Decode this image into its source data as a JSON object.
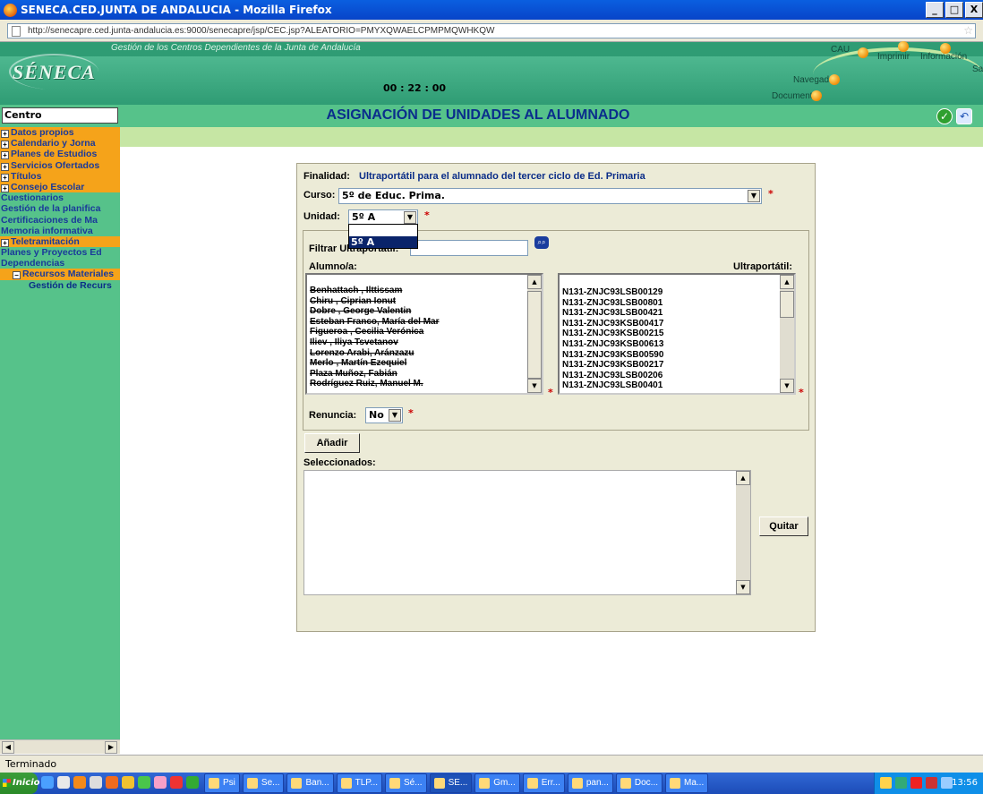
{
  "window": {
    "title": "SENECA.CED.JUNTA DE ANDALUCIA - Mozilla Firefox",
    "buttons": [
      "_",
      "□",
      "X"
    ]
  },
  "browser": {
    "url": "http://senecapre.ced.junta-andalucia.es:9000/senecapre/jsp/CEC.jsp?ALEATORIO=PMYXQWAELCPMPMQWHKQW",
    "status": "Terminado"
  },
  "header": {
    "logo": "SÉNECA",
    "subtitle": "Gestión de los Centros Dependientes de la Junta de Andalucía",
    "timer": "00 : 22 : 00",
    "links": {
      "cau": "CAU",
      "imprimir": "Imprimir",
      "informacion": "Información",
      "salir": "Sal",
      "navegador": "Navegador",
      "documentos": "Documentos"
    }
  },
  "sidebar": {
    "centro": "Centro",
    "items": [
      {
        "label": "Datos propios",
        "kind": "or"
      },
      {
        "label": "Calendario y Jorna",
        "kind": "or"
      },
      {
        "label": "Planes de Estudios",
        "kind": "or"
      },
      {
        "label": "Servicios Ofertados",
        "kind": "or"
      },
      {
        "label": "Títulos",
        "kind": "or"
      },
      {
        "label": "Consejo Escolar",
        "kind": "or"
      },
      {
        "label": "Cuestionarios",
        "kind": "plain"
      },
      {
        "label": "Gestión de la planifica",
        "kind": "plain"
      },
      {
        "label": "Certificaciones de Ma",
        "kind": "plain"
      },
      {
        "label": "Memoria informativa",
        "kind": "plain"
      },
      {
        "label": "Teletramitación",
        "kind": "or"
      },
      {
        "label": "Planes y Proyectos Ed",
        "kind": "plain"
      },
      {
        "label": "Dependencias",
        "kind": "plain"
      },
      {
        "label": "Recursos Materiales",
        "kind": "sub"
      },
      {
        "label": "Gestión de Recurs",
        "kind": "selsub"
      }
    ]
  },
  "main": {
    "title": "ASIGNACIÓN DE UNIDADES AL ALUMNADO",
    "finalidad_label": "Finalidad:",
    "finalidad_value": "Ultraportátil para el alumnado del tercer ciclo de Ed. Primaria",
    "curso_label": "Curso:",
    "curso_value": "5º de Educ. Prima.",
    "unidad_label": "Unidad:",
    "unidad_value": "5º A",
    "unidad_options": [
      "",
      "5º A"
    ],
    "filtrar_label": "Filtrar Ultraportátil:",
    "alumno_label": "Alumno/a:",
    "ultraportatil_label": "Ultraportátil:",
    "alumnos": [
      "Benhattach , Ilttissam",
      "Chiru , Ciprian Ionut",
      "Dobre , George Valentin",
      "Esteban Franco, María del Mar",
      "Figueroa , Cecilia Verónica",
      "Iliev , Iliya Tsvetanov",
      "Lorenzo Arabi, Aránzazu",
      "Merlo , Martín Ezequiel",
      "Plaza Muñoz, Fabián",
      "Rodríguez Ruiz, Manuel M."
    ],
    "ultraportatiles": [
      "N131-ZNJC93LSB00129",
      "N131-ZNJC93LSB00801",
      "N131-ZNJC93LSB00421",
      "N131-ZNJC93KSB00417",
      "N131-ZNJC93KSB00215",
      "N131-ZNJC93KSB00613",
      "N131-ZNJC93KSB00590",
      "N131-ZNJC93KSB00217",
      "N131-ZNJC93LSB00206",
      "N131-ZNJC93LSB00401"
    ],
    "renuncia_label": "Renuncia:",
    "renuncia_value": "No",
    "anadir_label": "Añadir",
    "seleccionados_label": "Seleccionados:",
    "quitar_label": "Quitar",
    "required_mark": "*"
  },
  "taskbar": {
    "start": "Inicio",
    "tasks": [
      "Psi",
      "Se...",
      "Ban...",
      "TLP...",
      "Sé...",
      "SE...",
      "Gm...",
      "Err...",
      "pan...",
      "Doc...",
      "Ma..."
    ],
    "active_task": "SE...",
    "clock": "13:56"
  },
  "colors": {
    "header_green": "#56c28a",
    "nav_orange": "#f5a31a",
    "title_blue": "#0a2d8c",
    "panel_bg": "#ecebd7"
  }
}
